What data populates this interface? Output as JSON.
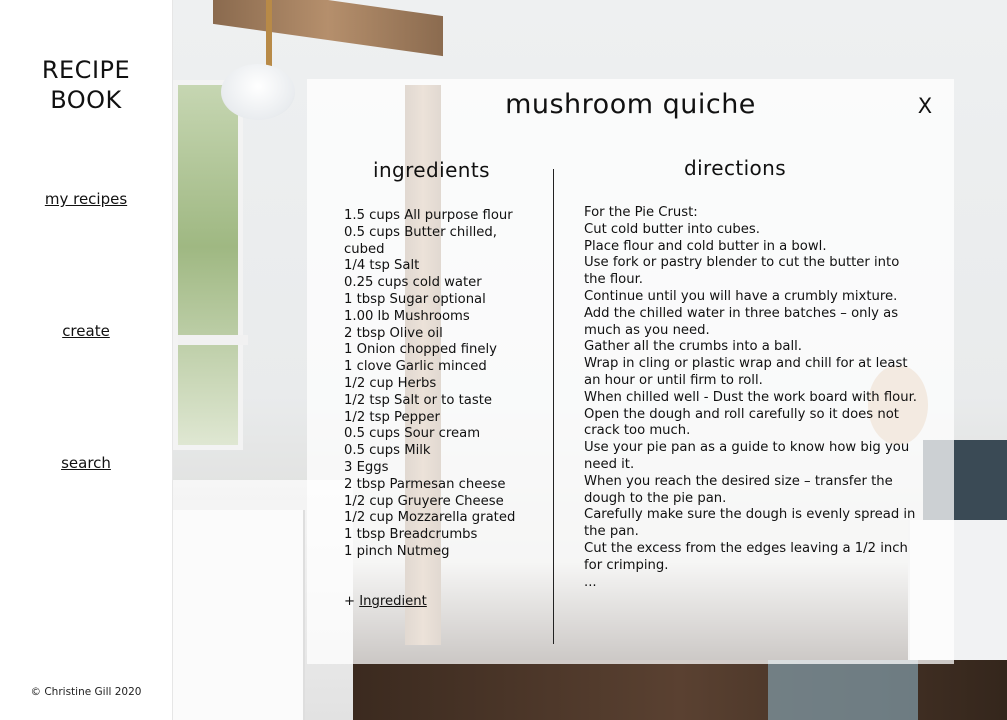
{
  "sidebar": {
    "brand_line1": "RECIPE",
    "brand_line2": "BOOK",
    "nav": [
      {
        "label": "my recipes"
      },
      {
        "label": "create"
      },
      {
        "label": "search"
      }
    ],
    "footer": "© Christine Gill 2020"
  },
  "recipe": {
    "title": "mushroom quiche",
    "close_label": "X",
    "ingredients_heading": "ingredients",
    "directions_heading": "directions",
    "ingredients": [
      "1.5 cups All purpose flour",
      "0.5 cups Butter chilled, cubed",
      "1/4 tsp Salt",
      "0.25 cups cold water",
      "1 tbsp Sugar optional",
      "1.00 lb Mushrooms",
      "2 tbsp Olive oil",
      "1 Onion chopped finely",
      "1 clove Garlic minced",
      "1/2 cup Herbs",
      "1/2 tsp Salt or to taste",
      "1/2 tsp Pepper",
      "0.5 cups Sour cream",
      "0.5 cups Milk",
      "3 Eggs",
      "2 tbsp Parmesan cheese",
      "1/2 cup Gruyere Cheese",
      "1/2 cup Mozzarella grated",
      "1 tbsp Breadcrumbs",
      "1 pinch Nutmeg"
    ],
    "add_prefix": "+ ",
    "add_label": "Ingredient",
    "directions": [
      "For the Pie Crust:",
      "Cut cold butter into cubes.",
      "Place flour and cold butter in a bowl.",
      "Use fork or pastry blender to cut the butter into the flour.",
      "Continue until you will have a crumbly mixture.",
      "Add the chilled water in three batches – only as much as you need.",
      "Gather all the crumbs into a ball.",
      "Wrap in cling or plastic wrap and chill for at least an hour or until firm to roll.",
      "When chilled well  - Dust the work board with flour.",
      "Open the dough and roll carefully so it does not crack too much.",
      "Use your pie pan as a guide to know how big you need it.",
      "When you reach the desired size – transfer the dough to the pie pan.",
      "Carefully make sure the dough is evenly spread in the pan.",
      "Cut the excess from the edges leaving a 1/2 inch for crimping.",
      "..."
    ]
  }
}
